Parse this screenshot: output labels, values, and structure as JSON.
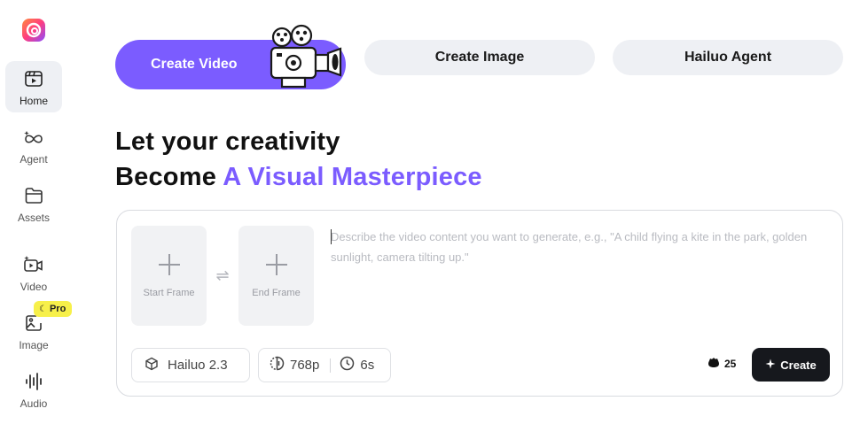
{
  "sidebar": {
    "items": [
      {
        "label": "Home",
        "icon": "home-icon",
        "active": true
      },
      {
        "label": "Agent",
        "icon": "agent-icon"
      },
      {
        "label": "Assets",
        "icon": "folder-icon"
      },
      {
        "label": "Video",
        "icon": "video-icon"
      },
      {
        "label": "Image",
        "icon": "image-icon"
      },
      {
        "label": "Audio",
        "icon": "audio-icon"
      }
    ],
    "pro_badge": "Pro"
  },
  "tabs": {
    "video": "Create Video",
    "image": "Create Image",
    "agent": "Hailuo Agent"
  },
  "headline": {
    "line1": "Let your creativity",
    "line2_prefix": "Become ",
    "line2_accent": "A Visual Masterpiece"
  },
  "composer": {
    "start_frame": "Start Frame",
    "end_frame": "End Frame",
    "prompt_placeholder": "Describe the video content you want to generate, e.g., \"A child flying a kite in the park, golden sunlight, camera tilting up.\"",
    "model": "Hailuo 2.3",
    "resolution": "768p",
    "duration": "6s",
    "credits": "25",
    "create_label": "Create"
  },
  "colors": {
    "accent": "#7b5cff",
    "button_dark": "#16181d",
    "pro_yellow": "#f7f04a"
  }
}
